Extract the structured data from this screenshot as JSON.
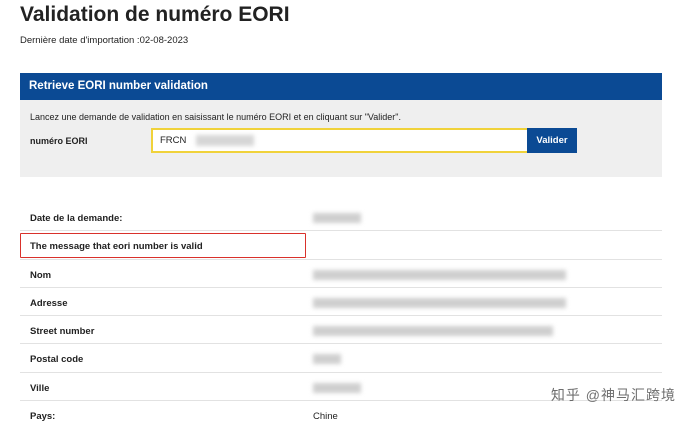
{
  "page": {
    "title": "Validation de numéro EORI",
    "import_date": "Dernière date d'importation :02-08-2023"
  },
  "panel": {
    "header": "Retrieve EORI number validation",
    "instructions": "Lancez une demande de validation en saisissant le numéro EORI et en cliquant sur \"Valider\".",
    "eori_label": "numéro EORI",
    "eori_value": "FRCN",
    "valider_label": "Valider"
  },
  "results": [
    {
      "label": "Date de la demande:",
      "value": null
    },
    {
      "label": "The message that eori number is valid",
      "value": null
    },
    {
      "label": "Nom",
      "value": null
    },
    {
      "label": "Adresse",
      "value": null
    },
    {
      "label": "Street number",
      "value": null
    },
    {
      "label": "Postal code",
      "value": null
    },
    {
      "label": "Ville",
      "value": null
    },
    {
      "label": "Pays:",
      "value": "Chine"
    }
  ],
  "watermark": "知乎 @神马汇跨境",
  "colors": {
    "header_blue": "#0b4a94",
    "input_border": "#f0d23a",
    "highlight": "#d9312b"
  }
}
